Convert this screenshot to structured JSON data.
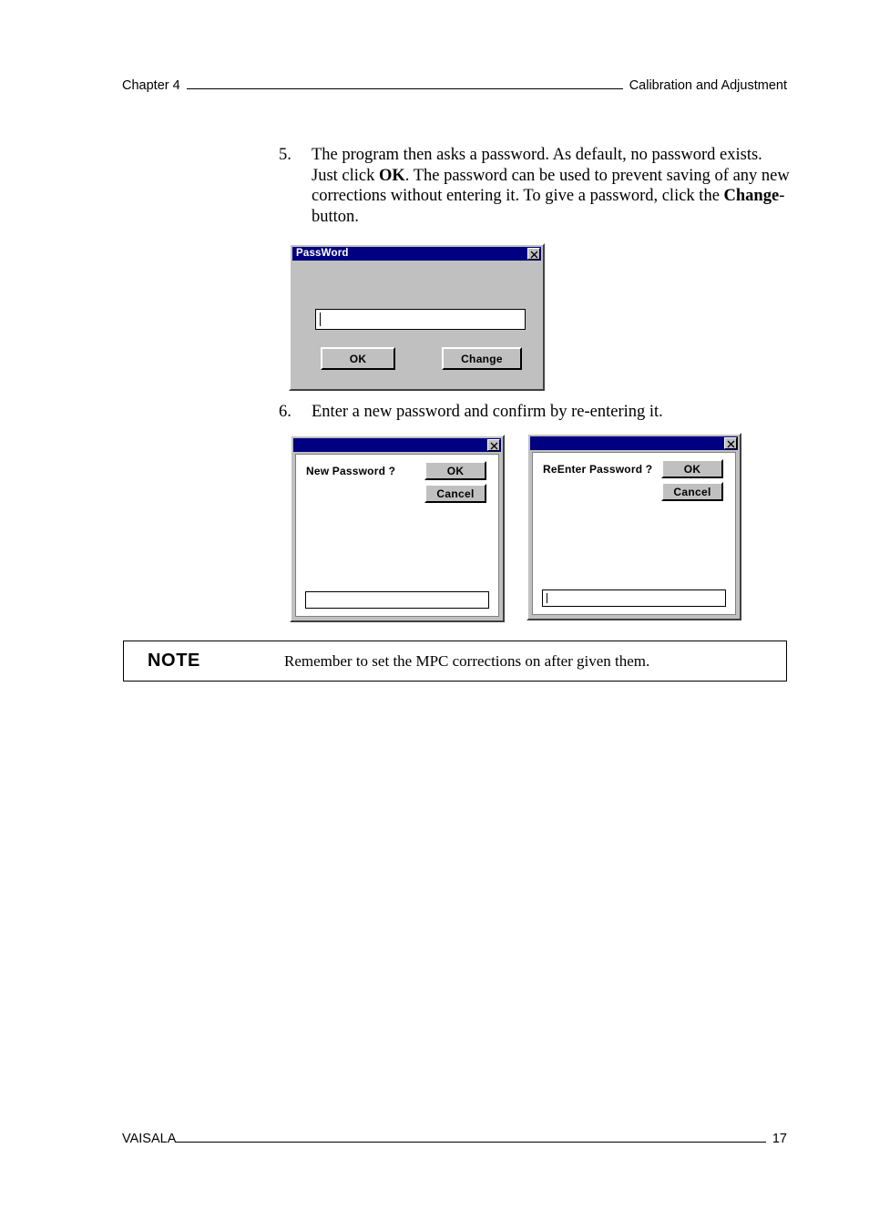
{
  "header": {
    "left": "Chapter 4",
    "right": "Calibration and Adjustment"
  },
  "steps": [
    {
      "number": "5.",
      "text_part_1": "The program then asks a password. As default, no password exists. Just click ",
      "bold_1": "OK",
      "text_part_2": ". The password can be used to prevent saving of any new corrections without entering it. To give a password, click the ",
      "bold_2": "Change",
      "text_part_3": "-button."
    },
    {
      "number": "6.",
      "text": "Enter a new password and confirm by re-entering it."
    }
  ],
  "dialogs": {
    "password": {
      "title": "PassWord",
      "close_icon": "close-icon",
      "input_value": "",
      "input_has_caret": true,
      "ok_label": "OK",
      "change_label": "Change"
    },
    "new_password": {
      "title": "",
      "close_icon": "close-icon",
      "prompt": "New Password ?",
      "ok_label": "OK",
      "cancel_label": "Cancel",
      "input_value": "",
      "input_has_caret": false
    },
    "reenter_password": {
      "title": "",
      "close_icon": "close-icon",
      "prompt": "ReEnter Password ?",
      "ok_label": "OK",
      "cancel_label": "Cancel",
      "input_value": "",
      "input_has_caret": true
    }
  },
  "note": {
    "label": "NOTE",
    "text": "Remember to set the MPC corrections on after given them."
  },
  "footer": {
    "left": "VAISALA",
    "page_number": "17"
  },
  "colors": {
    "titlebar": "#000080",
    "dialog_face": "#c0c0c0",
    "page_background": "#ffffff",
    "text": "#000000"
  }
}
